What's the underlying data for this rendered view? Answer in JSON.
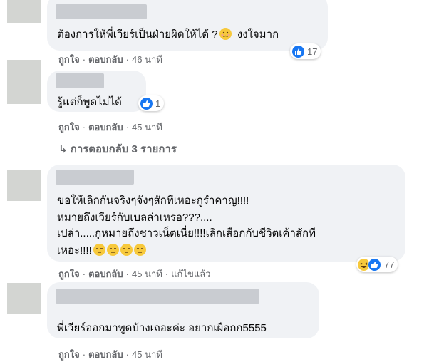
{
  "comments": [
    {
      "text": "ต้องการให้พี่เวียร์เป็นฝ่ายผิดให้ได้ ?",
      "text_after": "งงใจมาก",
      "reaction_count": "17",
      "actions": {
        "like": "ถูกใจ",
        "reply": "ตอบกลับ",
        "time": "46 นาที"
      }
    },
    {
      "text": "รู้แต่ก็พูดไม่ได้",
      "reaction_count": "1",
      "actions": {
        "like": "ถูกใจ",
        "reply": "ตอบกลับ",
        "time": "45 นาที"
      }
    },
    {
      "lines": [
        "ขอให้เลิกกันจริงๆจังๆสักทีเหอะกูรำคาญ!!!!",
        "หมายถึงเวียร์กับเบลล่าเหรอ???....",
        "เปล่า.....กูหมายถึงชาวเน็ตเนี่ย!!!!เลิกเสือกกับชีวิตเค้าสักที",
        "เหอะ!!!!"
      ],
      "reaction_count": "77",
      "actions": {
        "like": "ถูกใจ",
        "reply": "ตอบกลับ",
        "time": "45 นาที",
        "edited": "แก้ไขแล้ว"
      }
    },
    {
      "text": "พี่เวียร์ออกมาพูดบ้างเถอะค่ะ อยากเผือกก5555",
      "actions": {
        "like": "ถูกใจ",
        "reply": "ตอบกลับ",
        "time": "45 นาที"
      }
    }
  ],
  "replies_link": {
    "arrow": "↳",
    "label": "การตอบกลับ 3 รายการ"
  },
  "icons": {
    "like": "thumbs-up-icon",
    "haha": "haha-emoji-icon",
    "sad": "unamused-emoji-icon",
    "confused": "confused-emoji-icon"
  },
  "colors": {
    "bubble": "#f0f2f5",
    "muted": "#65676b",
    "like_blue": "#1877f2",
    "emoji_yellow": "#f7c93c"
  }
}
